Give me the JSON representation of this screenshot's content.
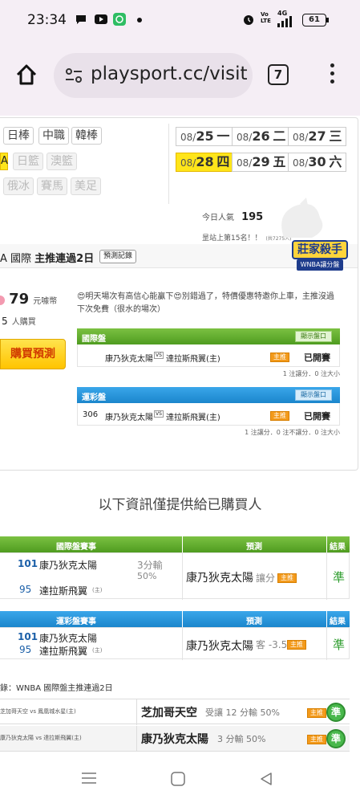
{
  "status_bar": {
    "time": "23:34",
    "battery": "61",
    "network": "4G",
    "volte": "Vo LTE"
  },
  "browser": {
    "url": "playsport.cc/visit",
    "tab_count": "7"
  },
  "sports_tabs": {
    "row1": [
      "日棒",
      "中職",
      "韓棒"
    ],
    "row2_lead": "A",
    "row2": [
      "日籃",
      "澳籃"
    ],
    "row3": [
      "俄冰",
      "賽馬",
      "美足"
    ]
  },
  "dates": [
    {
      "md": "08/",
      "d": "25",
      "w": "一",
      "selected": false
    },
    {
      "md": "08/",
      "d": "26",
      "w": "二",
      "selected": false
    },
    {
      "md": "08/",
      "d": "27",
      "w": "三",
      "selected": false
    },
    {
      "md": "08/",
      "d": "28",
      "w": "四",
      "selected": true
    },
    {
      "md": "08/",
      "d": "29",
      "w": "五",
      "selected": false
    },
    {
      "md": "08/",
      "d": "30",
      "w": "六",
      "selected": false
    }
  ],
  "popularity": {
    "label": "今日人氣",
    "value": "195",
    "rank_text": "昰站上第15名！！",
    "rank_total": "(共7275人)"
  },
  "seller": {
    "title_prefix": "A 國際",
    "title_bold": "主推連過2日",
    "record_button": "預測記錄",
    "badge_title": "莊家殺手",
    "badge_sub": "WNBA讓分盤",
    "price": "79",
    "price_unit": "元噱幣",
    "buyers": "5",
    "buyers_unit": "人購買",
    "buy_button": "購買預測",
    "message": "😍明天場次有高信心能贏下😍別錯過了，特價優惠特邀你上車，主推沒過下次免費（很水的場次）"
  },
  "intl_block": {
    "header": "國際盤",
    "show_odds": "顯示盤口",
    "match": "康乃狄克太陽",
    "vs": "VS",
    "opponent": "達拉斯飛翼(主)",
    "tag": "主推",
    "status": "已開賽",
    "footnote": "1 注讓分．0 注大小"
  },
  "lottery_block": {
    "header": "運彩盤",
    "show_odds": "顯示盤口",
    "number": "306",
    "match": "康乃狄克太陽",
    "vs": "VS",
    "opponent": "達拉斯飛翼(主)",
    "tag": "主推",
    "status": "已開賽",
    "footnote": "1 注讓分．0 注不讓分．0 注大小"
  },
  "buyers_only_text": "以下資訊僅提供給已購買人",
  "result_table_intl": {
    "headers": [
      "國際盤賽事",
      "預測",
      "結果"
    ],
    "team1_score": "101",
    "team1": "康乃狄克太陽",
    "team2_score": "95",
    "team2": "達拉斯飛翼",
    "home_mark": "(主)",
    "odds": "3分輸",
    "odds2": "50%",
    "pick": "康乃狄克太陽",
    "pick_type": "讓分",
    "tag": "主推",
    "result": "準"
  },
  "result_table_lottery": {
    "headers": [
      "運彩盤賽事",
      "預測",
      "結果"
    ],
    "team1_score": "101",
    "team1": "康乃狄克太陽",
    "team2_score": "95",
    "team2": "達拉斯飛翼",
    "home_mark": "(主)",
    "pick": "康乃狄克太陽",
    "pick_type": "客 -3.5",
    "tag": "主推",
    "result": "準"
  },
  "history": {
    "title": "錄：WNBA 國際盤主推連過2日",
    "rows": [
      {
        "match": "芝加哥天空 vs 鳳凰城水星(主)",
        "pick": "芝加哥天空",
        "detail": "受讓 12 分輸 50%",
        "tag": "主推",
        "result": "準"
      },
      {
        "match": "康乃狄克太陽 vs 達拉斯飛翼(主)",
        "pick": "康乃狄克太陽",
        "detail": "3 分輸 50%",
        "tag": "主推",
        "result": "準"
      }
    ]
  }
}
